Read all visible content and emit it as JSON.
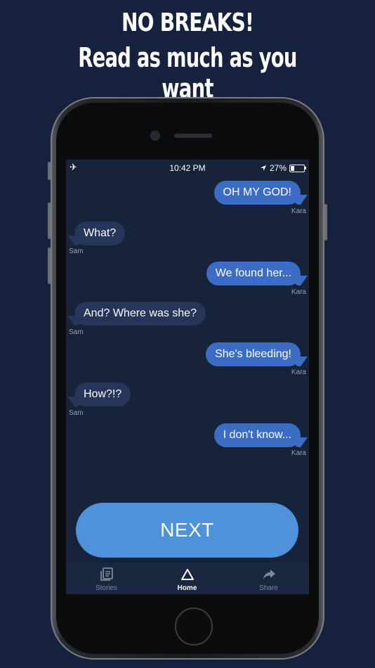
{
  "promo": {
    "headline": "NO BREAKS!",
    "subheadline": "Read as much as you want"
  },
  "status_bar": {
    "time": "10:42 PM",
    "battery": "27%",
    "battery_level": 0.27
  },
  "messages": [
    {
      "side": "right",
      "text": "OH MY GOD!",
      "sender": "Kara"
    },
    {
      "side": "left",
      "text": "What?",
      "sender": "Sam"
    },
    {
      "side": "right",
      "text": "We found her...",
      "sender": "Kara"
    },
    {
      "side": "left",
      "text": "And? Where was she?",
      "sender": "Sam"
    },
    {
      "side": "right",
      "text": "She's bleeding!",
      "sender": "Kara"
    },
    {
      "side": "left",
      "text": "How?!?",
      "sender": "Sam"
    },
    {
      "side": "right",
      "text": "I don't know...",
      "sender": "Kara"
    }
  ],
  "next_button": {
    "label": "NEXT"
  },
  "tabbar": {
    "tabs": [
      {
        "label": "Stories",
        "icon": "stories-icon",
        "active": false
      },
      {
        "label": "Home",
        "icon": "home-triangle-icon",
        "active": true
      },
      {
        "label": "Share",
        "icon": "share-icon",
        "active": false
      }
    ]
  },
  "colors": {
    "background": "#16223d",
    "screen": "#172338",
    "bubble_right": "#3b6dc4",
    "bubble_left": "#26355a",
    "next_button": "#4f92dc"
  }
}
